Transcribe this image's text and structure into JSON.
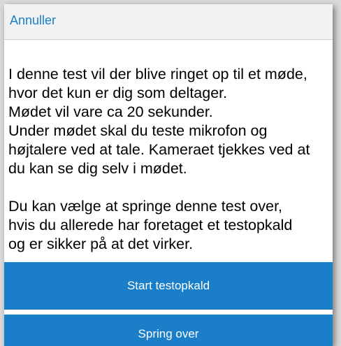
{
  "header": {
    "cancel_label": "Annuller"
  },
  "message": {
    "paragraph1": "I denne test vil der blive ringet op til et møde,\nhvor det kun er dig som deltager.\nMødet vil vare ca 20 sekunder.\nUnder mødet skal du teste mikrofon og\nhøjtalere ved at tale. Kameraet tjekkes ved at\ndu kan se dig selv i mødet.",
    "paragraph2": "Du kan vælge at springe denne test over,\nhvis du allerede har foretaget et testopkald\nog er sikker på at det virker."
  },
  "actions": {
    "start_label": "Start testopkald",
    "skip_label": "Spring over"
  },
  "colors": {
    "accent": "#1a7ec9",
    "header_bg": "#f2f2f2",
    "content_bg": "#ffffff"
  }
}
